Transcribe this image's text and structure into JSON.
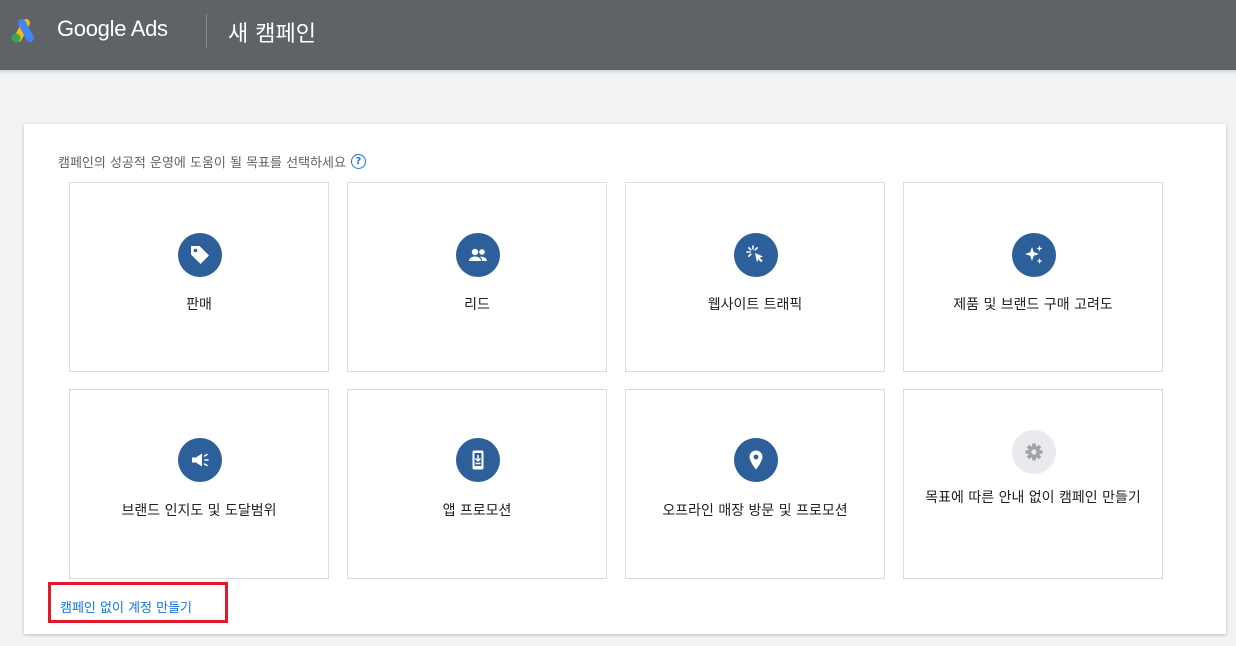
{
  "header": {
    "brand": "Google Ads",
    "title": "새 캠페인",
    "logo_icon": "google-ads-logo",
    "colors": {
      "bar": "#5f6368",
      "logo_yellow": "#fbbc04",
      "logo_blue": "#4285f4",
      "logo_green": "#34a853"
    }
  },
  "main": {
    "prompt": "캠페인의 성공적 운영에 도움이 될 목표를 선택하세요",
    "help_icon": "help-circle-icon",
    "cards": [
      {
        "label": "판매",
        "icon": "tag-icon"
      },
      {
        "label": "리드",
        "icon": "people-icon"
      },
      {
        "label": "웹사이트 트래픽",
        "icon": "cursor-click-icon"
      },
      {
        "label": "제품 및 브랜드 구매 고려도",
        "icon": "sparkle-icon"
      },
      {
        "label": "브랜드 인지도 및 도달범위",
        "icon": "megaphone-icon"
      },
      {
        "label": "앱 프로모션",
        "icon": "phone-download-icon"
      },
      {
        "label": "오프라인 매장 방문 및 프로모션",
        "icon": "location-pin-icon"
      },
      {
        "label": "목표에 따른 안내 없이 캠페인 만들기",
        "icon": "gear-icon"
      }
    ],
    "account_link": "캠페인 없이 계정 만들기",
    "colors": {
      "icon_circle": "#2d5f9a",
      "link": "#1a73e8",
      "highlight": "#e0192c"
    }
  }
}
